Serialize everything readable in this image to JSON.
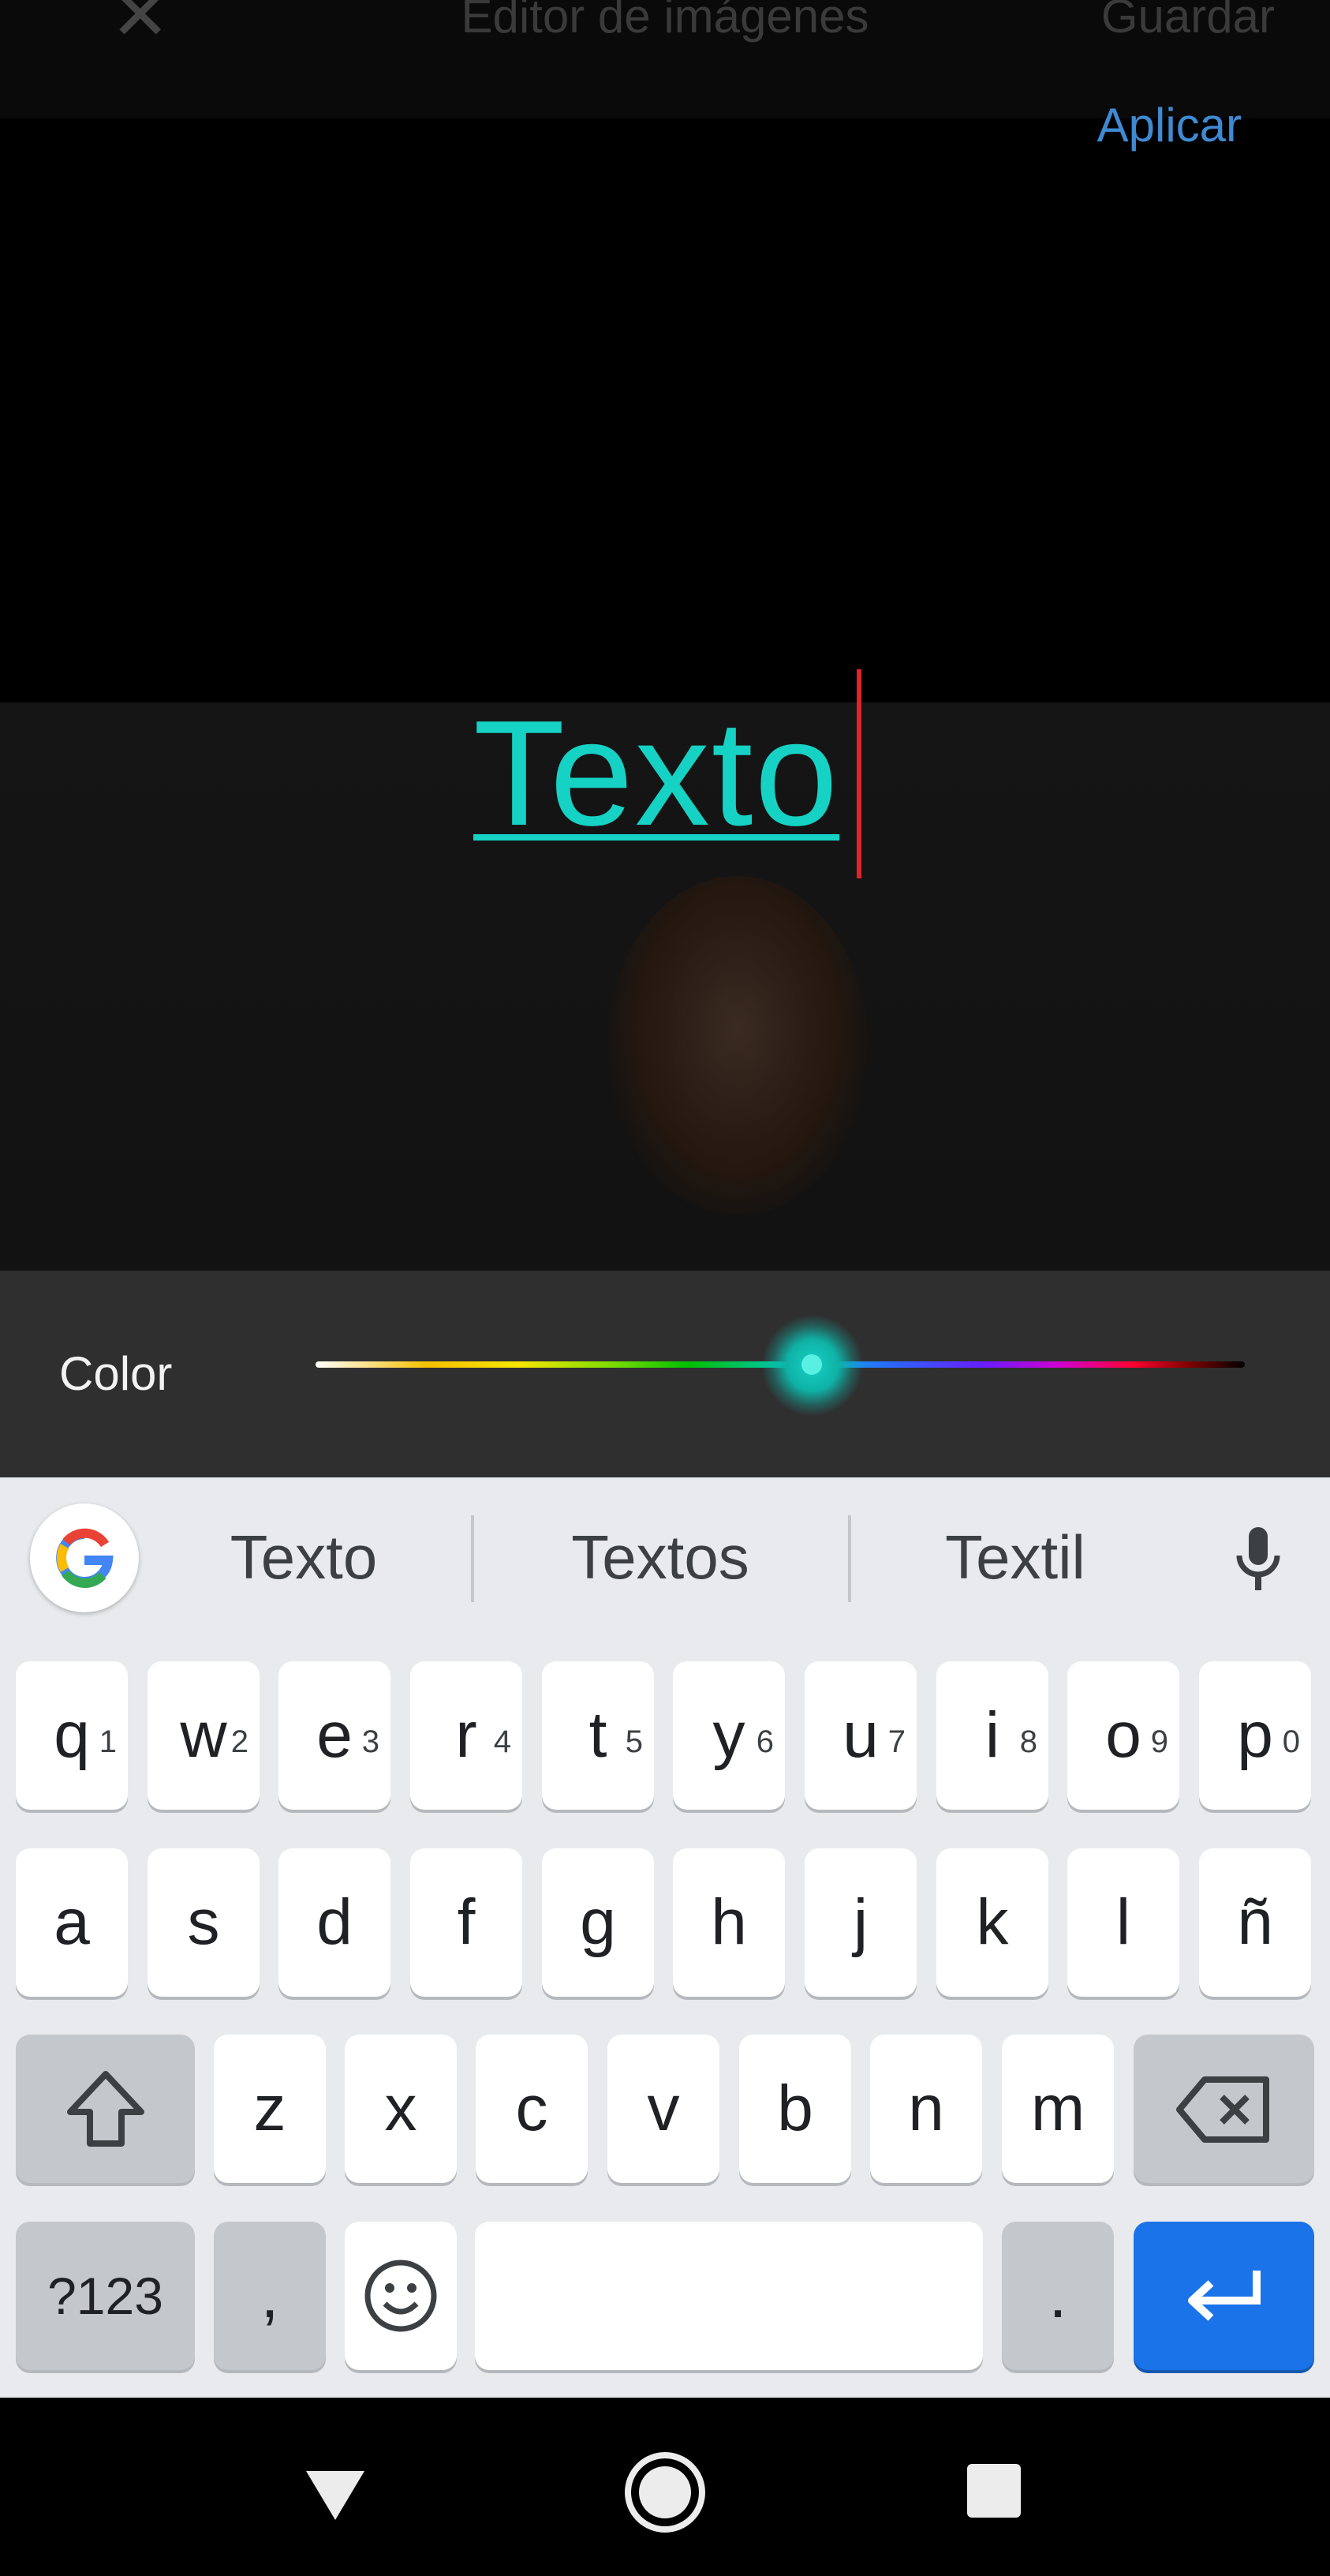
{
  "header": {
    "close_glyph": "✕",
    "title": "Editor de imágenes",
    "save_label": "Guardar",
    "apply_label": "Aplicar"
  },
  "canvas": {
    "text": "Texto",
    "text_color": "#16d2c4",
    "caret_color": "#e0232b"
  },
  "color_panel": {
    "label": "Color",
    "slider_value_percent": 52
  },
  "keyboard": {
    "suggestions": [
      "Texto",
      "Textos",
      "Textil"
    ],
    "row1": [
      {
        "k": "q",
        "n": "1"
      },
      {
        "k": "w",
        "n": "2"
      },
      {
        "k": "e",
        "n": "3"
      },
      {
        "k": "r",
        "n": "4"
      },
      {
        "k": "t",
        "n": "5"
      },
      {
        "k": "y",
        "n": "6"
      },
      {
        "k": "u",
        "n": "7"
      },
      {
        "k": "i",
        "n": "8"
      },
      {
        "k": "o",
        "n": "9"
      },
      {
        "k": "p",
        "n": "0"
      }
    ],
    "row2": [
      "a",
      "s",
      "d",
      "f",
      "g",
      "h",
      "j",
      "k",
      "l",
      "ñ"
    ],
    "row3": [
      "z",
      "x",
      "c",
      "v",
      "b",
      "n",
      "m"
    ],
    "symbols_label": "?123",
    "comma_label": ",",
    "period_label": "."
  },
  "colors": {
    "accent": "#3f8ad3",
    "enter": "#1a73e8",
    "keyboard_bg": "#e8eaed"
  }
}
